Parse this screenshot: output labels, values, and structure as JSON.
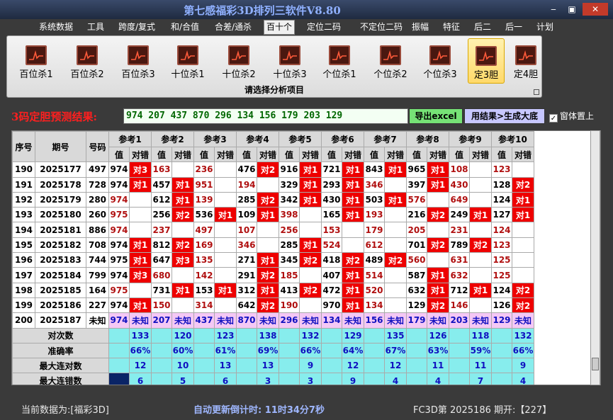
{
  "app": {
    "title": "第七感福彩3D排列三软件V8.80",
    "min": "‒",
    "max": "▣",
    "close": "✕"
  },
  "menu": [
    "系统数据",
    "工具",
    "跨度/复式",
    "和/合值",
    "合差/通杀",
    "百十个",
    "定位二码",
    "不定位二码",
    "振幅",
    "特征",
    "后二",
    "后一",
    "计划"
  ],
  "menu_active": 5,
  "ribbon": {
    "buttons": [
      "百位杀1",
      "百位杀2",
      "百位杀3",
      "十位杀1",
      "十位杀2",
      "十位杀3",
      "个位杀1",
      "个位杀2",
      "个位杀3",
      "定3胆",
      "定4胆"
    ],
    "selected": 9,
    "caption": "请选择分析项目"
  },
  "prediction": {
    "label": "3码定胆预测结果:",
    "value": "974 207 437 870 296 134 156 179 203 129",
    "export_button": "导出excel",
    "generate_button": "用结果>生成大底",
    "on_top_label": "窗体置上",
    "on_top_checked": "✓"
  },
  "grid": {
    "headers": {
      "seq": "序号",
      "period": "期号",
      "number": "号码",
      "refs": [
        "参考1",
        "参考2",
        "参考3",
        "参考4",
        "参考5",
        "参考6",
        "参考7",
        "参考8",
        "参考9",
        "参考10"
      ],
      "val": "值",
      "flag": "对错"
    },
    "rows": [
      {
        "seq": "190",
        "period": "2025177",
        "num": "497",
        "cells": [
          [
            "974",
            "对3"
          ],
          [
            "163",
            ""
          ],
          [
            "236",
            ""
          ],
          [
            "476",
            "对2"
          ],
          [
            "916",
            "对1"
          ],
          [
            "721",
            "对1"
          ],
          [
            "843",
            "对1"
          ],
          [
            "965",
            "对1"
          ],
          [
            "108",
            ""
          ],
          [
            "123",
            ""
          ]
        ]
      },
      {
        "seq": "191",
        "period": "2025178",
        "num": "728",
        "cells": [
          [
            "974",
            "对1"
          ],
          [
            "457",
            "对1"
          ],
          [
            "951",
            ""
          ],
          [
            "194",
            ""
          ],
          [
            "329",
            "对1"
          ],
          [
            "293",
            "对1"
          ],
          [
            "346",
            ""
          ],
          [
            "397",
            "对1"
          ],
          [
            "430",
            ""
          ],
          [
            "128",
            "对2"
          ]
        ]
      },
      {
        "seq": "192",
        "period": "2025179",
        "num": "280",
        "cells": [
          [
            "974",
            ""
          ],
          [
            "612",
            "对1"
          ],
          [
            "139",
            ""
          ],
          [
            "285",
            "对2"
          ],
          [
            "342",
            "对1"
          ],
          [
            "430",
            "对1"
          ],
          [
            "503",
            "对1"
          ],
          [
            "576",
            ""
          ],
          [
            "649",
            ""
          ],
          [
            "124",
            "对1"
          ]
        ]
      },
      {
        "seq": "193",
        "period": "2025180",
        "num": "260",
        "cells": [
          [
            "975",
            ""
          ],
          [
            "256",
            "对2"
          ],
          [
            "536",
            "对1"
          ],
          [
            "109",
            "对1"
          ],
          [
            "398",
            ""
          ],
          [
            "165",
            "对1"
          ],
          [
            "193",
            ""
          ],
          [
            "216",
            "对2"
          ],
          [
            "249",
            "对1"
          ],
          [
            "127",
            "对1"
          ]
        ]
      },
      {
        "seq": "194",
        "period": "2025181",
        "num": "886",
        "cells": [
          [
            "974",
            ""
          ],
          [
            "237",
            ""
          ],
          [
            "497",
            ""
          ],
          [
            "107",
            ""
          ],
          [
            "256",
            ""
          ],
          [
            "153",
            ""
          ],
          [
            "179",
            ""
          ],
          [
            "205",
            ""
          ],
          [
            "231",
            ""
          ],
          [
            "124",
            ""
          ]
        ]
      },
      {
        "seq": "195",
        "period": "2025182",
        "num": "708",
        "cells": [
          [
            "974",
            "对1"
          ],
          [
            "812",
            "对2"
          ],
          [
            "169",
            ""
          ],
          [
            "346",
            ""
          ],
          [
            "285",
            "对1"
          ],
          [
            "524",
            ""
          ],
          [
            "612",
            ""
          ],
          [
            "701",
            "对2"
          ],
          [
            "789",
            "对2"
          ],
          [
            "123",
            ""
          ]
        ]
      },
      {
        "seq": "196",
        "period": "2025183",
        "num": "744",
        "cells": [
          [
            "975",
            "对1"
          ],
          [
            "647",
            "对3"
          ],
          [
            "135",
            ""
          ],
          [
            "271",
            "对1"
          ],
          [
            "345",
            "对2"
          ],
          [
            "418",
            "对2"
          ],
          [
            "489",
            "对2"
          ],
          [
            "560",
            ""
          ],
          [
            "631",
            ""
          ],
          [
            "125",
            ""
          ]
        ]
      },
      {
        "seq": "197",
        "period": "2025184",
        "num": "799",
        "cells": [
          [
            "974",
            "对3"
          ],
          [
            "680",
            ""
          ],
          [
            "142",
            ""
          ],
          [
            "291",
            "对2"
          ],
          [
            "185",
            ""
          ],
          [
            "407",
            "对1"
          ],
          [
            "514",
            ""
          ],
          [
            "587",
            "对1"
          ],
          [
            "632",
            ""
          ],
          [
            "125",
            ""
          ]
        ]
      },
      {
        "seq": "198",
        "period": "2025185",
        "num": "164",
        "cells": [
          [
            "975",
            ""
          ],
          [
            "731",
            "对1"
          ],
          [
            "153",
            "对1"
          ],
          [
            "312",
            "对1"
          ],
          [
            "413",
            "对2"
          ],
          [
            "472",
            "对1"
          ],
          [
            "520",
            ""
          ],
          [
            "632",
            "对1"
          ],
          [
            "712",
            "对1"
          ],
          [
            "124",
            "对2"
          ]
        ]
      },
      {
        "seq": "199",
        "period": "2025186",
        "num": "227",
        "cells": [
          [
            "974",
            "对1"
          ],
          [
            "150",
            ""
          ],
          [
            "314",
            ""
          ],
          [
            "642",
            "对2"
          ],
          [
            "190",
            ""
          ],
          [
            "970",
            "对1"
          ],
          [
            "134",
            ""
          ],
          [
            "129",
            "对2"
          ],
          [
            "146",
            ""
          ],
          [
            "126",
            "对2"
          ]
        ]
      }
    ],
    "pending": {
      "seq": "200",
      "period": "2025187",
      "num": "未知",
      "cells": [
        [
          "974",
          "未知"
        ],
        [
          "207",
          "未知"
        ],
        [
          "437",
          "未知"
        ],
        [
          "870",
          "未知"
        ],
        [
          "296",
          "未知"
        ],
        [
          "134",
          "未知"
        ],
        [
          "156",
          "未知"
        ],
        [
          "179",
          "未知"
        ],
        [
          "203",
          "未知"
        ],
        [
          "129",
          "未知"
        ]
      ]
    },
    "stats": [
      {
        "label": "对次数",
        "values": [
          "133",
          "120",
          "123",
          "138",
          "132",
          "129",
          "135",
          "126",
          "118",
          "132"
        ]
      },
      {
        "label": "准确率",
        "values": [
          "66%",
          "60%",
          "61%",
          "69%",
          "66%",
          "64%",
          "67%",
          "63%",
          "59%",
          "66%"
        ]
      },
      {
        "label": "最大连对数",
        "values": [
          "12",
          "10",
          "13",
          "13",
          "9",
          "12",
          "12",
          "11",
          "11",
          "9"
        ]
      },
      {
        "label": "最大连错数",
        "values": [
          "6",
          "5",
          "6",
          "3",
          "3",
          "9",
          "4",
          "4",
          "7",
          "4"
        ]
      }
    ]
  },
  "status": {
    "current_data": "当前数据为:[福彩3D]",
    "countdown": "自动更新倒计时: 11时34分7秒",
    "issue": "FC3D第 2025186 期开:【227】"
  }
}
